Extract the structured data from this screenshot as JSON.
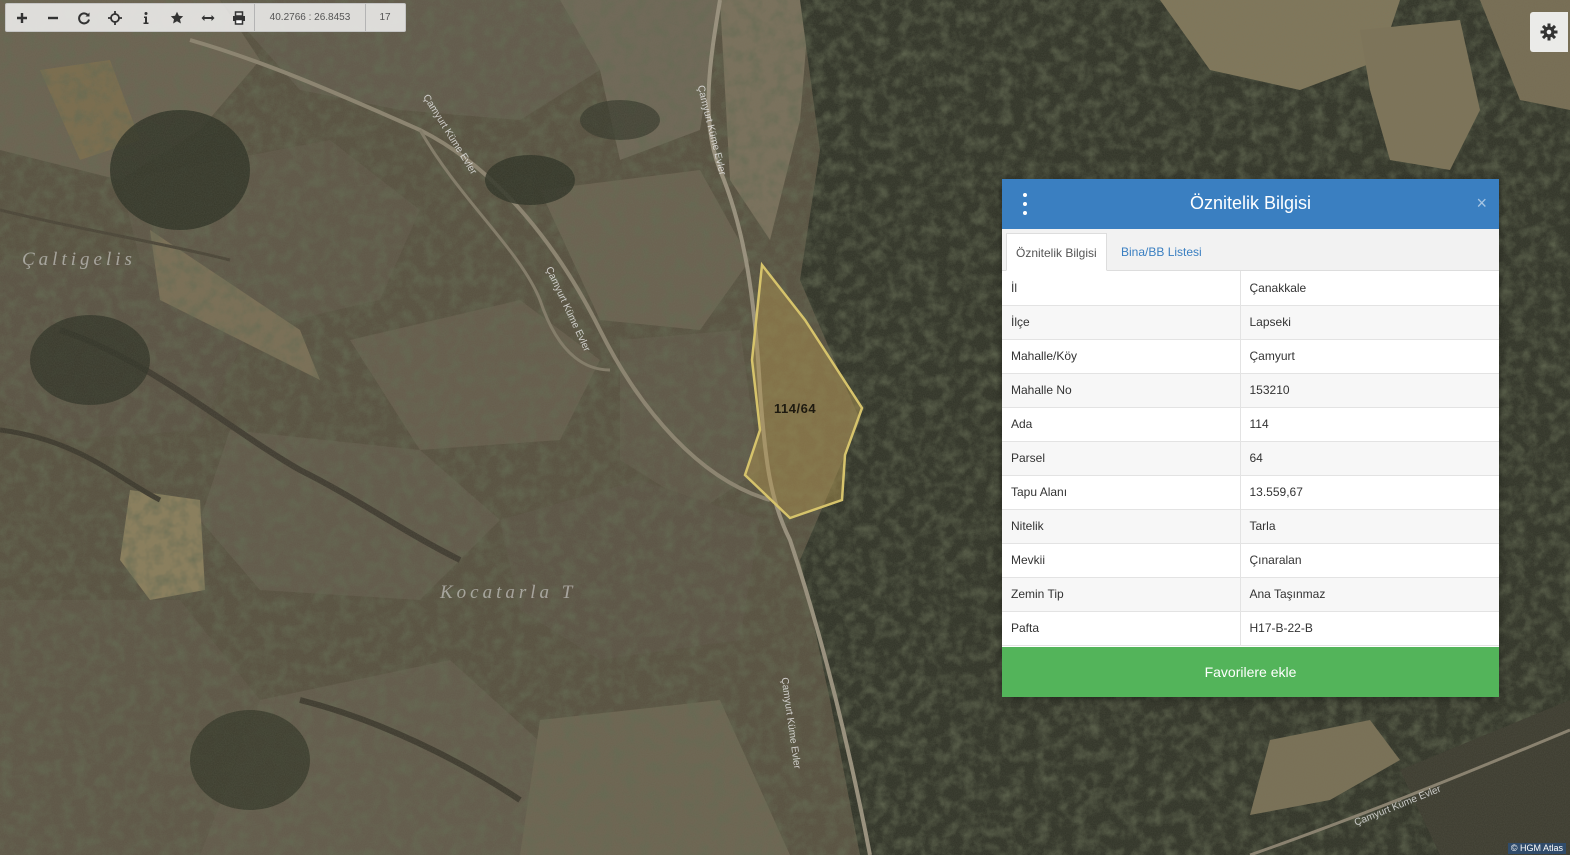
{
  "toolbar": {
    "coordinates": "40.2766 : 26.8453",
    "zoom_level": "17",
    "icons": [
      "plus-icon",
      "minus-icon",
      "refresh-icon",
      "crosshair-icon",
      "info-icon",
      "star-icon",
      "measure-icon",
      "print-icon"
    ]
  },
  "map": {
    "place_labels": [
      "Çaltigelis",
      "Kocatarla T"
    ],
    "road_label": "Çamyurt Küme Evler",
    "parcel_label": "114/64",
    "attribution": "© HGM Atlas"
  },
  "panel": {
    "title": "Öznitelik Bilgisi",
    "tabs": [
      "Öznitelik Bilgisi",
      "Bina/BB Listesi"
    ],
    "rows": [
      {
        "key": "İl",
        "value": "Çanakkale"
      },
      {
        "key": "İlçe",
        "value": "Lapseki"
      },
      {
        "key": "Mahalle/Köy",
        "value": "Çamyurt"
      },
      {
        "key": "Mahalle No",
        "value": "153210"
      },
      {
        "key": "Ada",
        "value": "114"
      },
      {
        "key": "Parsel",
        "value": "64"
      },
      {
        "key": "Tapu Alanı",
        "value": "13.559,67"
      },
      {
        "key": "Nitelik",
        "value": "Tarla"
      },
      {
        "key": "Mevkii",
        "value": "Çınaralan"
      },
      {
        "key": "Zemin Tip",
        "value": "Ana Taşınmaz"
      },
      {
        "key": "Pafta",
        "value": "H17-B-22-B"
      }
    ],
    "favorite_button": "Favorilere ekle",
    "close_symbol": "×"
  },
  "colors": {
    "header_blue": "#3a7fc1",
    "button_green": "#53b45a",
    "parcel_outline": "#d6c36b"
  }
}
